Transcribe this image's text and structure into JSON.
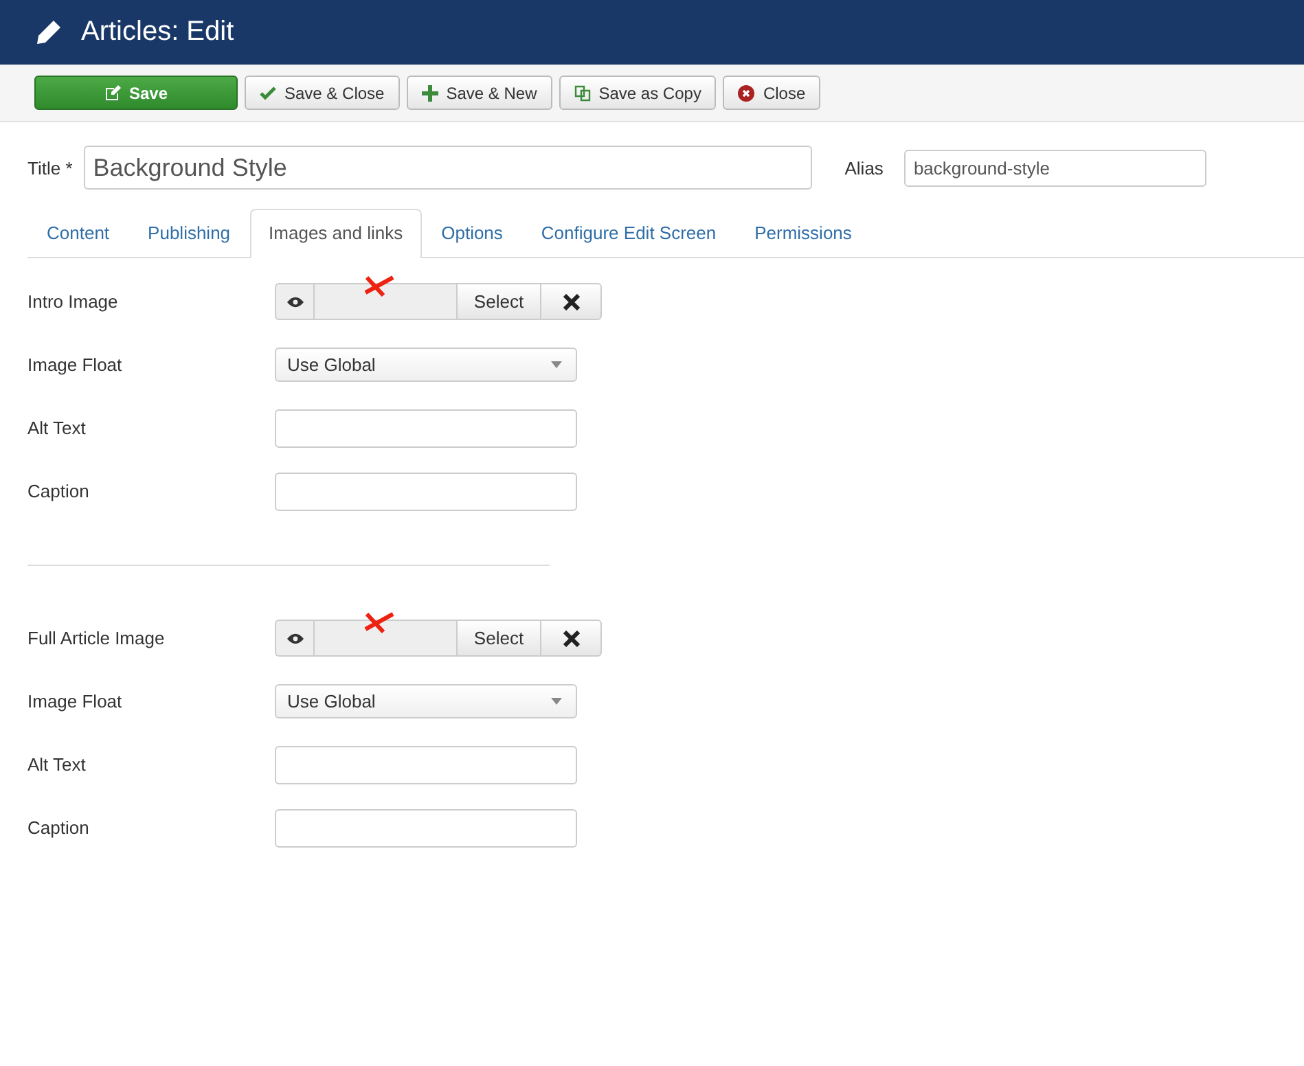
{
  "header": {
    "title": "Articles: Edit"
  },
  "toolbar": [
    {
      "label": "Save",
      "kind": "save"
    },
    {
      "label": "Save & Close",
      "kind": "check"
    },
    {
      "label": "Save & New",
      "kind": "new"
    },
    {
      "label": "Save as Copy",
      "kind": "copy"
    },
    {
      "label": "Close",
      "kind": "close"
    }
  ],
  "title_field": {
    "label": "Title *",
    "value": "Background Style"
  },
  "alias_field": {
    "label": "Alias",
    "value": "background-style"
  },
  "tabs": [
    {
      "label": "Content",
      "selected": false
    },
    {
      "label": "Publishing",
      "selected": false
    },
    {
      "label": "Images and links",
      "selected": true
    },
    {
      "label": "Options",
      "selected": false
    },
    {
      "label": "Configure Edit Screen",
      "selected": false
    },
    {
      "label": "Permissions",
      "selected": false
    }
  ],
  "groups": [
    {
      "fields": [
        {
          "label": "Intro Image",
          "kind": "image",
          "button": "Select",
          "annotated": true
        },
        {
          "label": "Image Float",
          "kind": "select",
          "value": "Use Global"
        },
        {
          "label": "Alt Text",
          "kind": "text"
        },
        {
          "label": "Caption",
          "kind": "text"
        }
      ]
    },
    {
      "fields": [
        {
          "label": "Full Article Image",
          "kind": "image",
          "button": "Select",
          "annotated": true
        },
        {
          "label": "Image Float",
          "kind": "select",
          "value": "Use Global"
        },
        {
          "label": "Alt Text",
          "kind": "text"
        },
        {
          "label": "Caption",
          "kind": "text"
        }
      ]
    }
  ]
}
